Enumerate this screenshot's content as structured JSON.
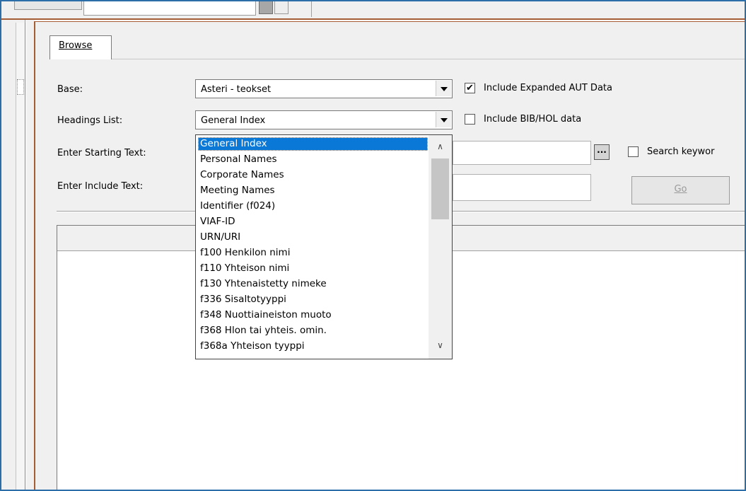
{
  "tabs": [
    {
      "label": "Browse"
    }
  ],
  "form": {
    "base_label": "Base:",
    "base_value": "Asteri - teokset",
    "headings_label": "Headings List:",
    "headings_value": "General Index",
    "starting_label": "Enter Starting Text:",
    "include_label": "Enter Include Text:",
    "go_label": "Go"
  },
  "checkboxes": {
    "expanded_aut": {
      "label": "Include Expanded AUT Data",
      "checked": true
    },
    "bib_hol": {
      "label": "Include BIB/HOL data",
      "checked": false
    },
    "search_keyword": {
      "label": "Search keywor",
      "checked": false
    }
  },
  "icons": {
    "dropdown_arrow": "chevron-down-icon",
    "scroll_up": "chevron-up-icon",
    "scroll_down": "chevron-down-icon",
    "ellipsis": "ellipsis-icon",
    "check": "checkmark-icon"
  },
  "glyphs": {
    "check": "✔",
    "ellipsis": "···",
    "up": "∧",
    "down": "∨"
  },
  "dropdown": {
    "selected_index": 0,
    "items": [
      "General Index",
      "Personal Names",
      "Corporate Names",
      "Meeting Names",
      "Identifier (f024)",
      "VIAF-ID",
      "URN/URI",
      "f100 Henkilon nimi",
      "f110 Yhteison nimi",
      "f130 Yhtenaistetty nimeke",
      "f336 Sisaltotyyppi",
      "f348 Nuottiaineiston muoto",
      "f368 Hlon tai yhteis. omin.",
      "f368a Yhteison tyyppi"
    ]
  },
  "colors": {
    "selection": "#0a78d7",
    "frame_border": "#2c6fa8",
    "panel_border": "#a55d35",
    "window_bg": "#f0f0f0"
  }
}
